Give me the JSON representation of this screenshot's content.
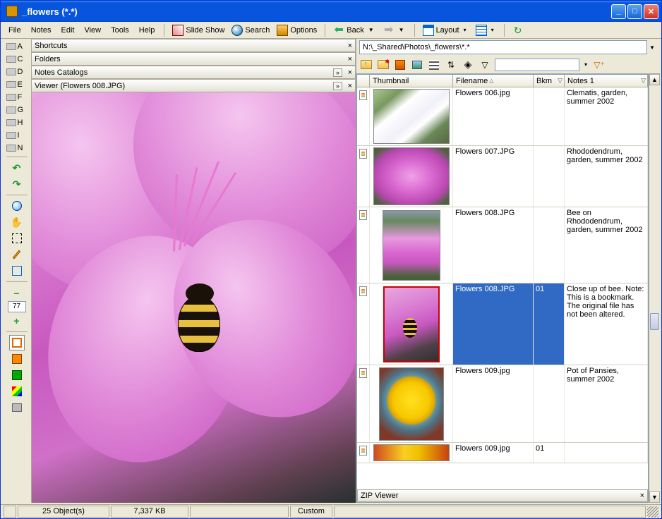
{
  "window": {
    "title": "_flowers (*.*)"
  },
  "menu": {
    "file": "File",
    "notes": "Notes",
    "edit": "Edit",
    "view": "View",
    "tools": "Tools",
    "help": "Help",
    "slideshow": "Slide Show",
    "search": "Search",
    "options": "Options",
    "back": "Back",
    "layout": "Layout"
  },
  "drives": [
    {
      "letter": "A"
    },
    {
      "letter": "C"
    },
    {
      "letter": "D"
    },
    {
      "letter": "E"
    },
    {
      "letter": "F"
    },
    {
      "letter": "G"
    },
    {
      "letter": "H"
    },
    {
      "letter": "I"
    },
    {
      "letter": "N"
    }
  ],
  "side": {
    "zoom": "77",
    "minus": "–",
    "plus": "+"
  },
  "accordion": {
    "shortcuts": "Shortcuts",
    "folders": "Folders",
    "catalogs": "Notes Catalogs",
    "viewer": "Viewer (Flowers 008.JPG)"
  },
  "address": {
    "path": "N:\\_Shared\\Photos\\_flowers\\*.*"
  },
  "columns": {
    "thumbnail": "Thumbnail",
    "filename": "Filename",
    "bkm": "Bkm",
    "notes1": "Notes 1"
  },
  "rows": [
    {
      "filename": "Flowers 006.jpg",
      "bkm": "",
      "notes": "Clematis, garden, summer 2002",
      "thumb": "th006",
      "selected": false,
      "thH": 82
    },
    {
      "filename": "Flowers 007.JPG",
      "bkm": "",
      "notes": "Rhododendrum, garden, summer 2002",
      "thumb": "th007",
      "selected": false,
      "thH": 86
    },
    {
      "filename": "Flowers 008.JPG",
      "bkm": "",
      "notes": "Bee on Rhododendrum, garden, summer 2002",
      "thumb": "th008a",
      "selected": false,
      "thH": 108
    },
    {
      "filename": "Flowers 008.JPG",
      "bkm": "01",
      "notes": "Close up of bee. Note: This is a bookmark. The original file has not been altered.",
      "thumb": "th008b",
      "selected": true,
      "thH": 116
    },
    {
      "filename": "Flowers 009.jpg",
      "bkm": "",
      "notes": "Pot of Pansies, summer 2002",
      "thumb": "th009a",
      "selected": false,
      "thH": 110
    },
    {
      "filename": "Flowers 009.jpg",
      "bkm": "01",
      "notes": "",
      "thumb": "th009b",
      "selected": false,
      "thH": 28
    }
  ],
  "zip": {
    "label": "ZIP Viewer"
  },
  "status": {
    "objects": "25 Object(s)",
    "size": "7,337 KB",
    "custom": "Custom"
  }
}
